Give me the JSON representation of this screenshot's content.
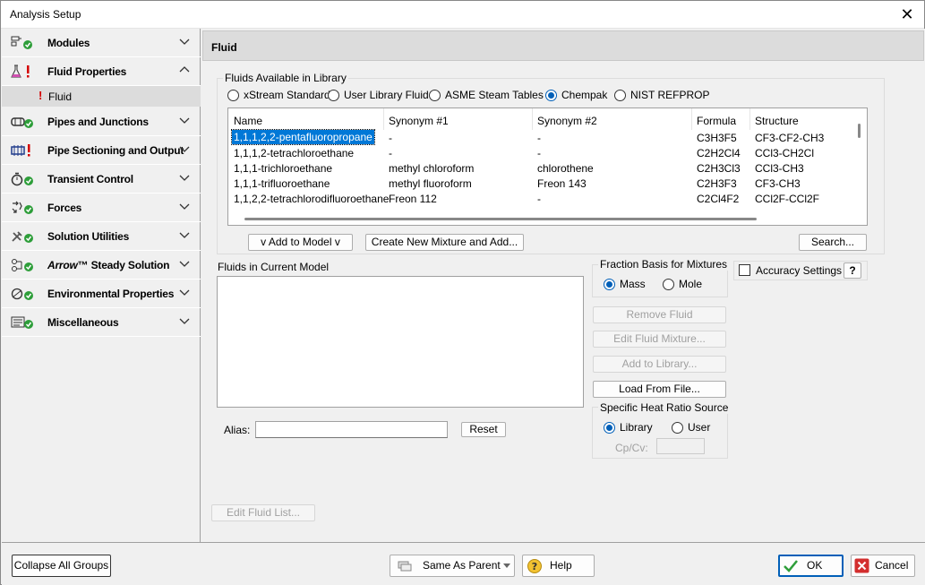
{
  "window": {
    "title": "Analysis Setup",
    "close_glyph": "✕"
  },
  "sidebar": {
    "groups": [
      {
        "label": "Modules",
        "icon": "modules-icon",
        "status": "ok"
      },
      {
        "label": "Fluid Properties",
        "icon": "flask-icon",
        "status": "error"
      },
      {
        "label": "Pipes and Junctions",
        "icon": "pipe-junction-icon",
        "status": "ok"
      },
      {
        "label": "Pipe Sectioning and Output",
        "icon": "pipe-section-icon",
        "status": "error"
      },
      {
        "label": "Transient Control",
        "icon": "timer-icon",
        "status": "ok"
      },
      {
        "label": "Forces",
        "icon": "forces-icon",
        "status": "ok"
      },
      {
        "label": "Solution Utilities",
        "icon": "tools-icon",
        "status": "ok"
      },
      {
        "label": "Arrow™ Steady Solution",
        "icon": "steady-solution-icon",
        "status": "ok",
        "brand": "Arrow",
        "suffix": "™ Steady Solution"
      },
      {
        "label": "Environmental Properties",
        "icon": "environment-icon",
        "status": "ok"
      },
      {
        "label": "Miscellaneous",
        "icon": "misc-icon",
        "status": "ok"
      }
    ],
    "sub_item": {
      "label": "Fluid",
      "status": "error",
      "status_glyph": "!"
    }
  },
  "panel": {
    "title": "Fluid"
  },
  "library": {
    "group_label": "Fluids Available in Library",
    "sources": [
      {
        "label": "xStream Standard",
        "selected": false
      },
      {
        "label": "User Library Fluid",
        "selected": false
      },
      {
        "label": "ASME Steam Tables",
        "selected": false
      },
      {
        "label": "Chempak",
        "selected": true
      },
      {
        "label": "NIST REFPROP",
        "selected": false
      }
    ],
    "columns": [
      "Name",
      "Synonym #1",
      "Synonym #2",
      "Formula",
      "Structure"
    ],
    "rows": [
      [
        "1,1,1,2,2-pentafluoropropane",
        "-",
        "-",
        "C3H3F5",
        "CF3-CF2-CH3"
      ],
      [
        "1,1,1,2-tetrachloroethane",
        "-",
        "-",
        "C2H2Cl4",
        "CCl3-CH2Cl"
      ],
      [
        "1,1,1-trichloroethane",
        "methyl chloroform",
        "chlorothene",
        "C2H3Cl3",
        "CCl3-CH3"
      ],
      [
        "1,1,1-trifluoroethane",
        "methyl fluoroform",
        "Freon 143",
        "C2H3F3",
        "CF3-CH3"
      ],
      [
        "1,1,2,2-tetrachlorodifluoroethane",
        "Freon 112",
        "-",
        "C2Cl4F2",
        "CCl2F-CCl2F"
      ]
    ],
    "selected_row": 0,
    "add_to_model": "v  Add to Model  v",
    "create_mixture": "Create New Mixture and Add...",
    "search": "Search..."
  },
  "model": {
    "group_label": "Fluids in Current Model",
    "alias_label": "Alias:",
    "alias_value": "",
    "reset": "Reset",
    "edit_fluid_list": "Edit Fluid List..."
  },
  "fraction_basis": {
    "label": "Fraction Basis for Mixtures",
    "options": [
      {
        "label": "Mass",
        "selected": true
      },
      {
        "label": "Mole",
        "selected": false
      }
    ]
  },
  "actions": {
    "remove_fluid": "Remove Fluid",
    "edit_mixture": "Edit Fluid Mixture...",
    "add_to_library": "Add to Library...",
    "load_from_file": "Load From File..."
  },
  "heat_ratio": {
    "label": "Specific Heat Ratio Source",
    "options": [
      {
        "label": "Library",
        "selected": true
      },
      {
        "label": "User",
        "selected": false
      }
    ],
    "cpcv_label": "Cp/Cv:",
    "cpcv_value": ""
  },
  "accuracy": {
    "label": "Accuracy Settings",
    "checked": false,
    "help": "?"
  },
  "footer": {
    "collapse": "Collapse All Groups",
    "same_as_parent": "Same As Parent",
    "help": "Help",
    "ok": "OK",
    "cancel": "Cancel"
  },
  "colors": {
    "ok_green": "#2e9e3a",
    "error_red": "#d40000",
    "accent": "#005fb8"
  }
}
